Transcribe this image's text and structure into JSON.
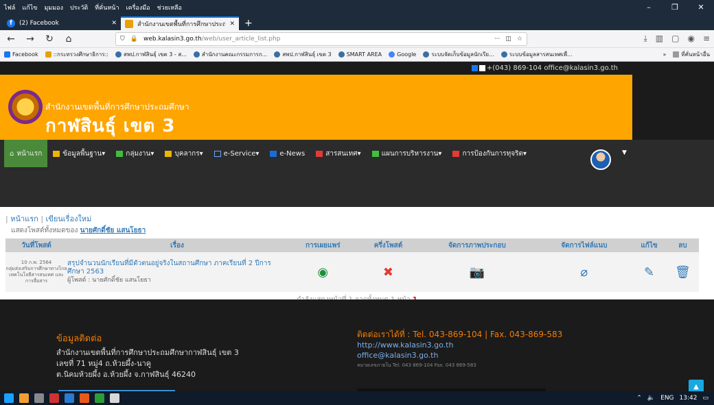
{
  "browser": {
    "menu": [
      "ไฟล์",
      "แก้ไข",
      "มุมมอง",
      "ประวัติ",
      "ที่คั่นหน้า",
      "เครื่องมือ",
      "ช่วยเหลือ"
    ],
    "tabs": [
      {
        "label": "(2) Facebook"
      },
      {
        "label": "สำนักงานเขตพื้นที่การศึกษาประถมศึก"
      }
    ],
    "url_host": "web.kalasin3.go.th",
    "url_path": "/web/user_article_list.php",
    "bookmarks": [
      "Facebook",
      "::กระทรวงศึกษาธิการ::",
      "สพป.กาฬสินธุ์ เขต 3 - ส...",
      "สำนักงานคณะกรรมการก...",
      "สพป.กาฬสินธุ์ เขต 3",
      "SMART AREA",
      "Google",
      "ระบบจัดเก็บข้อมูลนักเรีย...",
      "ระบบข้อมูลสารสนเทศเพื่..."
    ],
    "bookmarks_other": "ที่คั่นหน้าอื่น"
  },
  "site": {
    "top_contact": "+(043) 869-104  office@kalasin3.go.th",
    "banner_sub": "สำนักงานเขตพื้นที่การศึกษาประถมศึกษา",
    "banner_big": "กาฬสินธุ์ เขต 3",
    "nav": [
      "หน้าแรก",
      "ข้อมูลพื้นฐาน▾",
      "กลุ่มงาน▾",
      "บุคลากร▾",
      "e-Service▾",
      "e-News",
      "สารสนเทศ▾",
      "แผนการบริหารงาน▾",
      "การป้องกันการทุจริต▾"
    ]
  },
  "content": {
    "crumb_home": "หน้าแรก",
    "crumb_sep": "|",
    "crumb_new": "เขียนเรื่องใหม่",
    "showing_prefix": "แสดงโพสต์ทั้งหมดของ",
    "author_name": "นายศักดิ์ชัย แสนโยธา",
    "columns": [
      "วันที่โพสต์",
      "เรื่อง",
      "การเผยแพร่",
      "ครึ่งโพสต์",
      "จัดการภาพประกอบ",
      "จัดการไฟล์แนบ",
      "แก้ไข",
      "ลบ"
    ],
    "rows": [
      {
        "date": "10 ก.พ. 2564",
        "group": "กลุ่มส่งเสริมการศึกษาทางไกล เทคโนโลยีสารสนเทศ และการสื่อสาร",
        "title": "สรุปจำนวนนักเรียนที่มีตัวตนอยู่จริงในสถานศึกษา ภาคเรียนที่ 2 ปีการศึกษา 2563",
        "author": "ผู้โพสต์ : นายศักดิ์ชัย แสนโยธา"
      }
    ],
    "pager_text": "กำลังแสดงหน้าที่ 1 จากทั้งหมด 1 หน้า",
    "pager_page": "1"
  },
  "footer": {
    "left_head": "ข้อมูลติดต่อ",
    "left_lines": [
      "สำนักงานเขตพื้นที่การศึกษาประถมศึกษากาฬสินธุ์ เขต 3",
      "เลขที่ 71 หมู่4 ถ.ห้วยผึ้ง-นาคู",
      "ต.นิคมห้วยผึ้ง อ.ห้วยผึ้ง จ.กาฬสินธุ์ 46240"
    ],
    "right_head": "ติดต่อเราได้ที่ : Tel. 043-869-104 | Fax. 043-869-583",
    "right_web": "http://www.kalasin3.go.th",
    "right_mail": "office@kalasin3.go.th",
    "right_small": "หมายเลขภายใน Tel. 043 869-104 Fax. 043 869-583"
  },
  "taskbar": {
    "lang": "ENG",
    "time": "13:42"
  },
  "colors": {
    "accent": "#ffa500",
    "nav_bg": "#2b2b2b",
    "home_bg": "#4a8a3a",
    "link": "#337ab7"
  }
}
